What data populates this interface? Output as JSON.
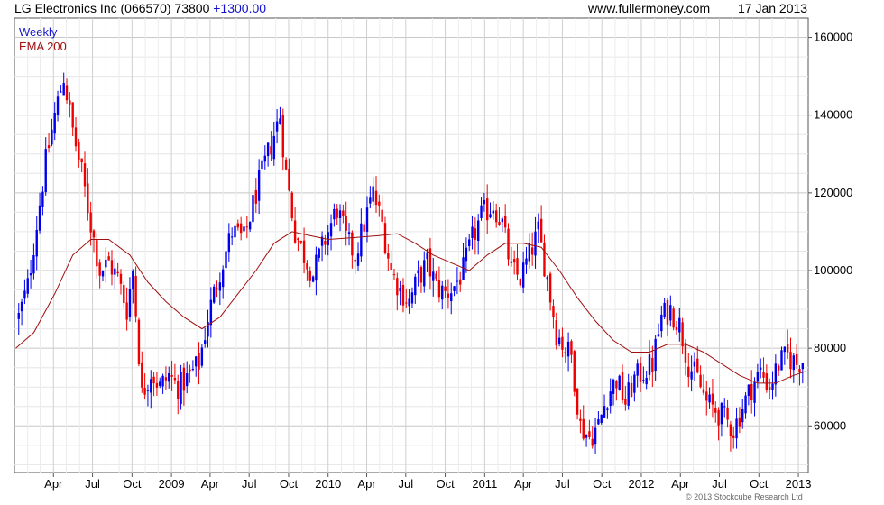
{
  "header": {
    "title": "LG Electronics Inc (066570) 73800",
    "change": "+1300.00",
    "site": "www.fullermoney.com",
    "date": "17 Jan 2013"
  },
  "footer": {
    "copyright": "© 2013 Stockcube Research Ltd"
  },
  "colors": {
    "up": "#0000ee",
    "down": "#ee0000",
    "ema": "#a01010",
    "grid": "#d8d8d8",
    "weekly_label": "#1a1acc",
    "ema_label": "#a01010"
  },
  "chart_data": {
    "type": "candlestick",
    "frequency": "weekly",
    "legend": [
      "Weekly",
      "EMA 200"
    ],
    "x_ticks": [
      "Apr",
      "Jul",
      "Oct",
      "2009",
      "Apr",
      "Jul",
      "Oct",
      "2010",
      "Apr",
      "Jul",
      "Oct",
      "2011",
      "Apr",
      "Jul",
      "Oct",
      "2012",
      "Apr",
      "Jul",
      "Oct",
      "2013"
    ],
    "y_ticks": [
      60000,
      80000,
      100000,
      120000,
      140000,
      160000
    ],
    "y_tick_labels": [
      "60000",
      "80000",
      "100000",
      "120000",
      "140000",
      "160000"
    ],
    "ylim": [
      48000,
      165000
    ],
    "grid": true,
    "price_keypoints": [
      {
        "x": "2008-01-11",
        "y": 88000
      },
      {
        "x": "2008-02-01",
        "y": 96000
      },
      {
        "x": "2008-02-22",
        "y": 112000
      },
      {
        "x": "2008-03-14",
        "y": 128000
      },
      {
        "x": "2008-04-04",
        "y": 140000
      },
      {
        "x": "2008-04-25",
        "y": 150000
      },
      {
        "x": "2008-05-16",
        "y": 136000
      },
      {
        "x": "2008-06-06",
        "y": 125000
      },
      {
        "x": "2008-06-27",
        "y": 112000
      },
      {
        "x": "2008-07-18",
        "y": 100000
      },
      {
        "x": "2008-08-08",
        "y": 102000
      },
      {
        "x": "2008-08-29",
        "y": 98000
      },
      {
        "x": "2008-09-19",
        "y": 90000
      },
      {
        "x": "2008-10-03",
        "y": 100000
      },
      {
        "x": "2008-10-24",
        "y": 68000
      },
      {
        "x": "2008-11-14",
        "y": 74000
      },
      {
        "x": "2008-12-05",
        "y": 70000
      },
      {
        "x": "2008-12-26",
        "y": 73000
      },
      {
        "x": "2009-01-16",
        "y": 70000
      },
      {
        "x": "2009-02-06",
        "y": 72000
      },
      {
        "x": "2009-03-06",
        "y": 76000
      },
      {
        "x": "2009-03-27",
        "y": 88000
      },
      {
        "x": "2009-04-24",
        "y": 100000
      },
      {
        "x": "2009-05-22",
        "y": 110000
      },
      {
        "x": "2009-06-19",
        "y": 108000
      },
      {
        "x": "2009-07-17",
        "y": 120000
      },
      {
        "x": "2009-08-14",
        "y": 130000
      },
      {
        "x": "2009-09-11",
        "y": 140000
      },
      {
        "x": "2009-09-25",
        "y": 125000
      },
      {
        "x": "2009-10-16",
        "y": 110000
      },
      {
        "x": "2009-11-06",
        "y": 104000
      },
      {
        "x": "2009-11-27",
        "y": 99000
      },
      {
        "x": "2009-12-25",
        "y": 108000
      },
      {
        "x": "2010-01-22",
        "y": 116000
      },
      {
        "x": "2010-02-12",
        "y": 108000
      },
      {
        "x": "2010-03-05",
        "y": 104000
      },
      {
        "x": "2010-03-26",
        "y": 112000
      },
      {
        "x": "2010-04-16",
        "y": 120000
      },
      {
        "x": "2010-05-07",
        "y": 112000
      },
      {
        "x": "2010-05-28",
        "y": 100000
      },
      {
        "x": "2010-06-18",
        "y": 95000
      },
      {
        "x": "2010-07-09",
        "y": 92000
      },
      {
        "x": "2010-07-30",
        "y": 98000
      },
      {
        "x": "2010-08-20",
        "y": 102000
      },
      {
        "x": "2010-09-10",
        "y": 96000
      },
      {
        "x": "2010-10-01",
        "y": 94000
      },
      {
        "x": "2010-10-22",
        "y": 96000
      },
      {
        "x": "2010-11-12",
        "y": 100000
      },
      {
        "x": "2010-12-03",
        "y": 108000
      },
      {
        "x": "2010-12-24",
        "y": 114000
      },
      {
        "x": "2011-01-21",
        "y": 117000
      },
      {
        "x": "2011-02-11",
        "y": 112000
      },
      {
        "x": "2011-03-04",
        "y": 100000
      },
      {
        "x": "2011-03-25",
        "y": 98000
      },
      {
        "x": "2011-04-15",
        "y": 104000
      },
      {
        "x": "2011-05-06",
        "y": 110000
      },
      {
        "x": "2011-05-27",
        "y": 98000
      },
      {
        "x": "2011-06-17",
        "y": 84000
      },
      {
        "x": "2011-07-08",
        "y": 80000
      },
      {
        "x": "2011-07-22",
        "y": 78000
      },
      {
        "x": "2011-08-12",
        "y": 60000
      },
      {
        "x": "2011-09-02",
        "y": 57000
      },
      {
        "x": "2011-09-23",
        "y": 60000
      },
      {
        "x": "2011-10-14",
        "y": 68000
      },
      {
        "x": "2011-11-04",
        "y": 72000
      },
      {
        "x": "2011-11-25",
        "y": 66000
      },
      {
        "x": "2011-12-16",
        "y": 72000
      },
      {
        "x": "2012-01-06",
        "y": 74000
      },
      {
        "x": "2012-01-27",
        "y": 76000
      },
      {
        "x": "2012-02-17",
        "y": 88000
      },
      {
        "x": "2012-03-09",
        "y": 90000
      },
      {
        "x": "2012-03-30",
        "y": 86000
      },
      {
        "x": "2012-04-20",
        "y": 76000
      },
      {
        "x": "2012-05-11",
        "y": 72000
      },
      {
        "x": "2012-06-01",
        "y": 66000
      },
      {
        "x": "2012-06-22",
        "y": 64000
      },
      {
        "x": "2012-07-13",
        "y": 62000
      },
      {
        "x": "2012-08-03",
        "y": 59000
      },
      {
        "x": "2012-08-24",
        "y": 65000
      },
      {
        "x": "2012-09-14",
        "y": 70000
      },
      {
        "x": "2012-10-05",
        "y": 74000
      },
      {
        "x": "2012-10-26",
        "y": 70000
      },
      {
        "x": "2012-11-16",
        "y": 76000
      },
      {
        "x": "2012-12-07",
        "y": 78000
      },
      {
        "x": "2012-12-28",
        "y": 76000
      },
      {
        "x": "2013-01-11",
        "y": 77000
      },
      {
        "x": "2013-01-17",
        "y": 73800
      }
    ],
    "ema_200": [
      {
        "x": "2008-01-04",
        "y": 80000
      },
      {
        "x": "2008-02-15",
        "y": 84000
      },
      {
        "x": "2008-04-04",
        "y": 94000
      },
      {
        "x": "2008-05-16",
        "y": 104000
      },
      {
        "x": "2008-06-27",
        "y": 108000
      },
      {
        "x": "2008-08-08",
        "y": 108000
      },
      {
        "x": "2008-09-26",
        "y": 104000
      },
      {
        "x": "2008-11-07",
        "y": 97000
      },
      {
        "x": "2008-12-19",
        "y": 92000
      },
      {
        "x": "2009-01-30",
        "y": 88000
      },
      {
        "x": "2009-03-13",
        "y": 85000
      },
      {
        "x": "2009-04-24",
        "y": 88000
      },
      {
        "x": "2009-06-05",
        "y": 94000
      },
      {
        "x": "2009-07-17",
        "y": 100000
      },
      {
        "x": "2009-08-28",
        "y": 107000
      },
      {
        "x": "2009-10-09",
        "y": 110000
      },
      {
        "x": "2009-11-20",
        "y": 109000
      },
      {
        "x": "2010-01-01",
        "y": 108000
      },
      {
        "x": "2010-03-05",
        "y": 108500
      },
      {
        "x": "2010-04-30",
        "y": 109000
      },
      {
        "x": "2010-06-11",
        "y": 109500
      },
      {
        "x": "2010-07-23",
        "y": 107000
      },
      {
        "x": "2010-09-03",
        "y": 104000
      },
      {
        "x": "2010-10-15",
        "y": 102000
      },
      {
        "x": "2010-11-26",
        "y": 100000
      },
      {
        "x": "2011-01-07",
        "y": 104000
      },
      {
        "x": "2011-02-18",
        "y": 107000
      },
      {
        "x": "2011-04-01",
        "y": 107000
      },
      {
        "x": "2011-05-13",
        "y": 106000
      },
      {
        "x": "2011-06-24",
        "y": 100000
      },
      {
        "x": "2011-08-05",
        "y": 93000
      },
      {
        "x": "2011-09-16",
        "y": 87000
      },
      {
        "x": "2011-10-28",
        "y": 82000
      },
      {
        "x": "2011-12-09",
        "y": 79000
      },
      {
        "x": "2012-01-20",
        "y": 79000
      },
      {
        "x": "2012-03-02",
        "y": 81000
      },
      {
        "x": "2012-04-13",
        "y": 81000
      },
      {
        "x": "2012-05-25",
        "y": 79000
      },
      {
        "x": "2012-07-06",
        "y": 76000
      },
      {
        "x": "2012-08-17",
        "y": 73000
      },
      {
        "x": "2012-09-28",
        "y": 71000
      },
      {
        "x": "2012-11-09",
        "y": 71000
      },
      {
        "x": "2012-12-21",
        "y": 73000
      },
      {
        "x": "2013-01-17",
        "y": 74000
      }
    ]
  }
}
